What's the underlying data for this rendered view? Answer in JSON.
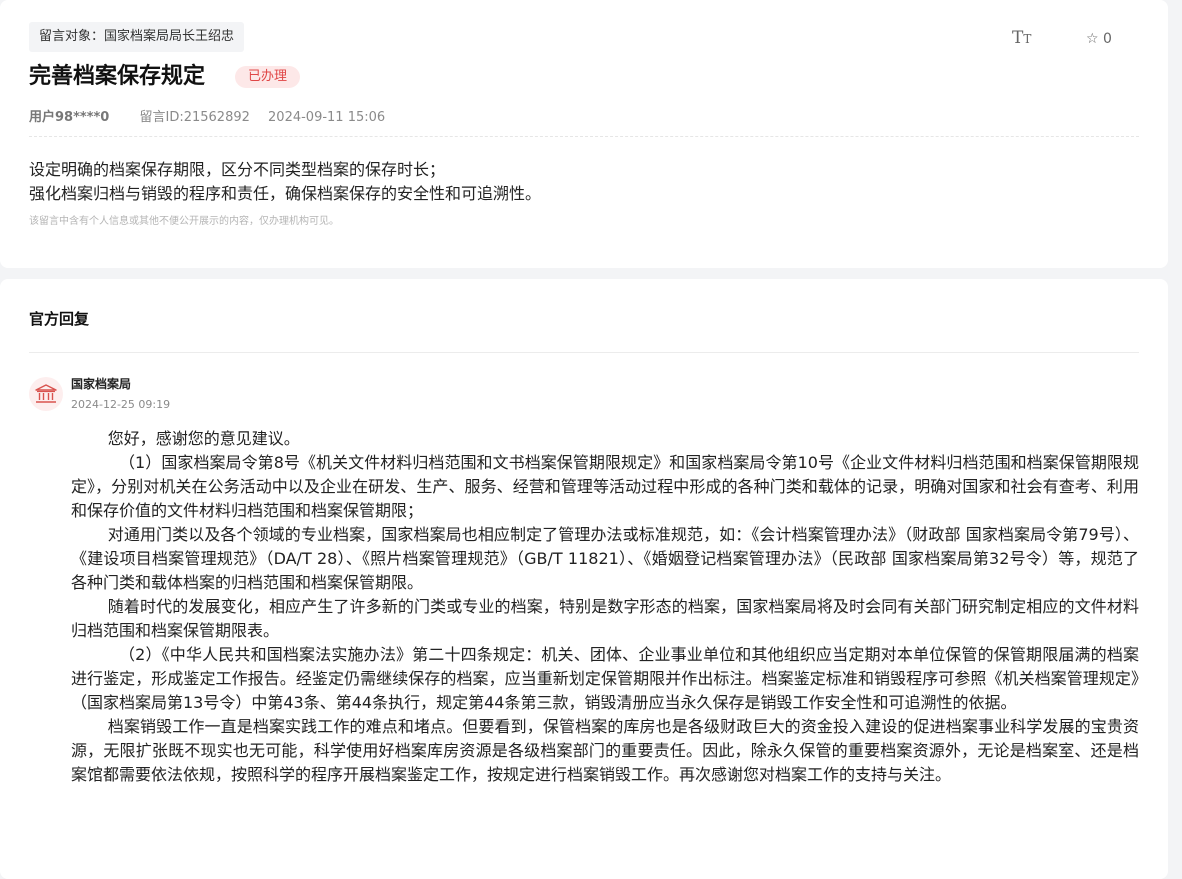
{
  "message": {
    "target_tag": "留言对象：国家档案局局长王绍忠",
    "font_size_icon": "font-size-icon",
    "favorite": {
      "icon": "star-outline-icon",
      "count": "0"
    },
    "title": "完善档案保存规定",
    "status": "已办理",
    "user": "用户98****0",
    "message_id": "留言ID:21562892",
    "time": "2024-09-11 15:06",
    "content": [
      "设定明确的档案保存期限，区分不同类型档案的保存时长；",
      "强化档案归档与销毁的程序和责任，确保档案保存的安全性和可追溯性。"
    ],
    "notice": "该留言中含有个人信息或其他不便公开展示的内容，仅办理机构可见。"
  },
  "reply": {
    "header": "官方回复",
    "agency": "国家档案局",
    "agency_icon": "government-building-icon",
    "time": "2024-12-25 09:19",
    "paragraphs": [
      "您好，感谢您的意见建议。",
      "（1）国家档案局令第8号《机关文件材料归档范围和文书档案保管期限规定》和国家档案局令第10号《企业文件材料归档范围和档案保管期限规定》，分别对机关在公务活动中以及企业在研发、生产、服务、经营和管理等活动过程中形成的各种门类和载体的记录，明确对国家和社会有查考、利用和保存价值的文件材料归档范围和档案保管期限；",
      "对通用门类以及各个领域的专业档案，国家档案局也相应制定了管理办法或标准规范，如：《会计档案管理办法》（财政部 国家档案局令第79号）、《建设项目档案管理规范》（DA/T 28）、《照片档案管理规范》（GB/T 11821）、《婚姻登记档案管理办法》（民政部 国家档案局第32号令）等，规范了各种门类和载体档案的归档范围和档案保管期限。",
      "随着时代的发展变化，相应产生了许多新的门类或专业的档案，特别是数字形态的档案，国家档案局将及时会同有关部门研究制定相应的文件材料归档范围和档案保管期限表。",
      "（2）《中华人民共和国档案法实施办法》第二十四条规定：机关、团体、企业事业单位和其他组织应当定期对本单位保管的保管期限届满的档案进行鉴定，形成鉴定工作报告。经鉴定仍需继续保存的档案，应当重新划定保管期限并作出标注。档案鉴定标准和销毁程序可参照《机关档案管理规定》（国家档案局第13号令）中第43条、第44条执行，规定第44条第三款，销毁清册应当永久保存是销毁工作安全性和可追溯性的依据。",
      "档案销毁工作一直是档案实践工作的难点和堵点。但要看到，保管档案的库房也是各级财政巨大的资金投入建设的促进档案事业科学发展的宝贵资源，无限扩张既不现实也无可能，科学使用好档案库房资源是各级档案部门的重要责任。因此，除永久保管的重要档案资源外，无论是档案室、还是档案馆都需要依法依规，按照科学的程序开展档案鉴定工作，按规定进行档案销毁工作。再次感谢您对档案工作的支持与关注。"
    ]
  },
  "colors": {
    "badge_text": "#e04646",
    "badge_bg": "#fde8e8",
    "page_bg": "#f3f4f6"
  }
}
